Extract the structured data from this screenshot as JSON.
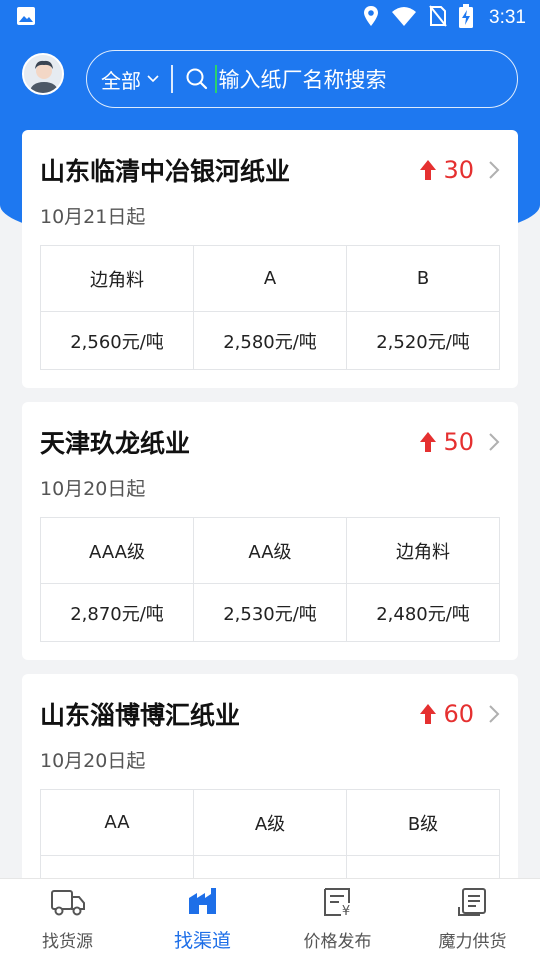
{
  "status_bar": {
    "time": "3:31"
  },
  "search": {
    "scope_label": "全部",
    "placeholder": "输入纸厂名称搜索"
  },
  "colors": {
    "primary": "#1e78f0",
    "up": "#e53030",
    "tab_active": "#1e6fe8"
  },
  "cards": [
    {
      "title": "山东临清中冶银河纸业",
      "change": "30",
      "date": "10月21日起",
      "grades": [
        "边角料",
        "A",
        "B"
      ],
      "prices": [
        "2,560元/吨",
        "2,580元/吨",
        "2,520元/吨"
      ]
    },
    {
      "title": "天津玖龙纸业",
      "change": "50",
      "date": "10月20日起",
      "grades": [
        "AAA级",
        "AA级",
        "边角料"
      ],
      "prices": [
        "2,870元/吨",
        "2,530元/吨",
        "2,480元/吨"
      ]
    },
    {
      "title": "山东淄博博汇纸业",
      "change": "60",
      "date": "10月20日起",
      "grades": [
        "AA",
        "A级",
        "B级"
      ],
      "prices": [
        "",
        "",
        ""
      ]
    }
  ],
  "tabs": [
    {
      "label": "找货源",
      "icon": "truck-icon"
    },
    {
      "label": "找渠道",
      "icon": "factory-icon"
    },
    {
      "label": "价格发布",
      "icon": "price-doc-icon"
    },
    {
      "label": "魔力供货",
      "icon": "list-doc-icon"
    }
  ]
}
